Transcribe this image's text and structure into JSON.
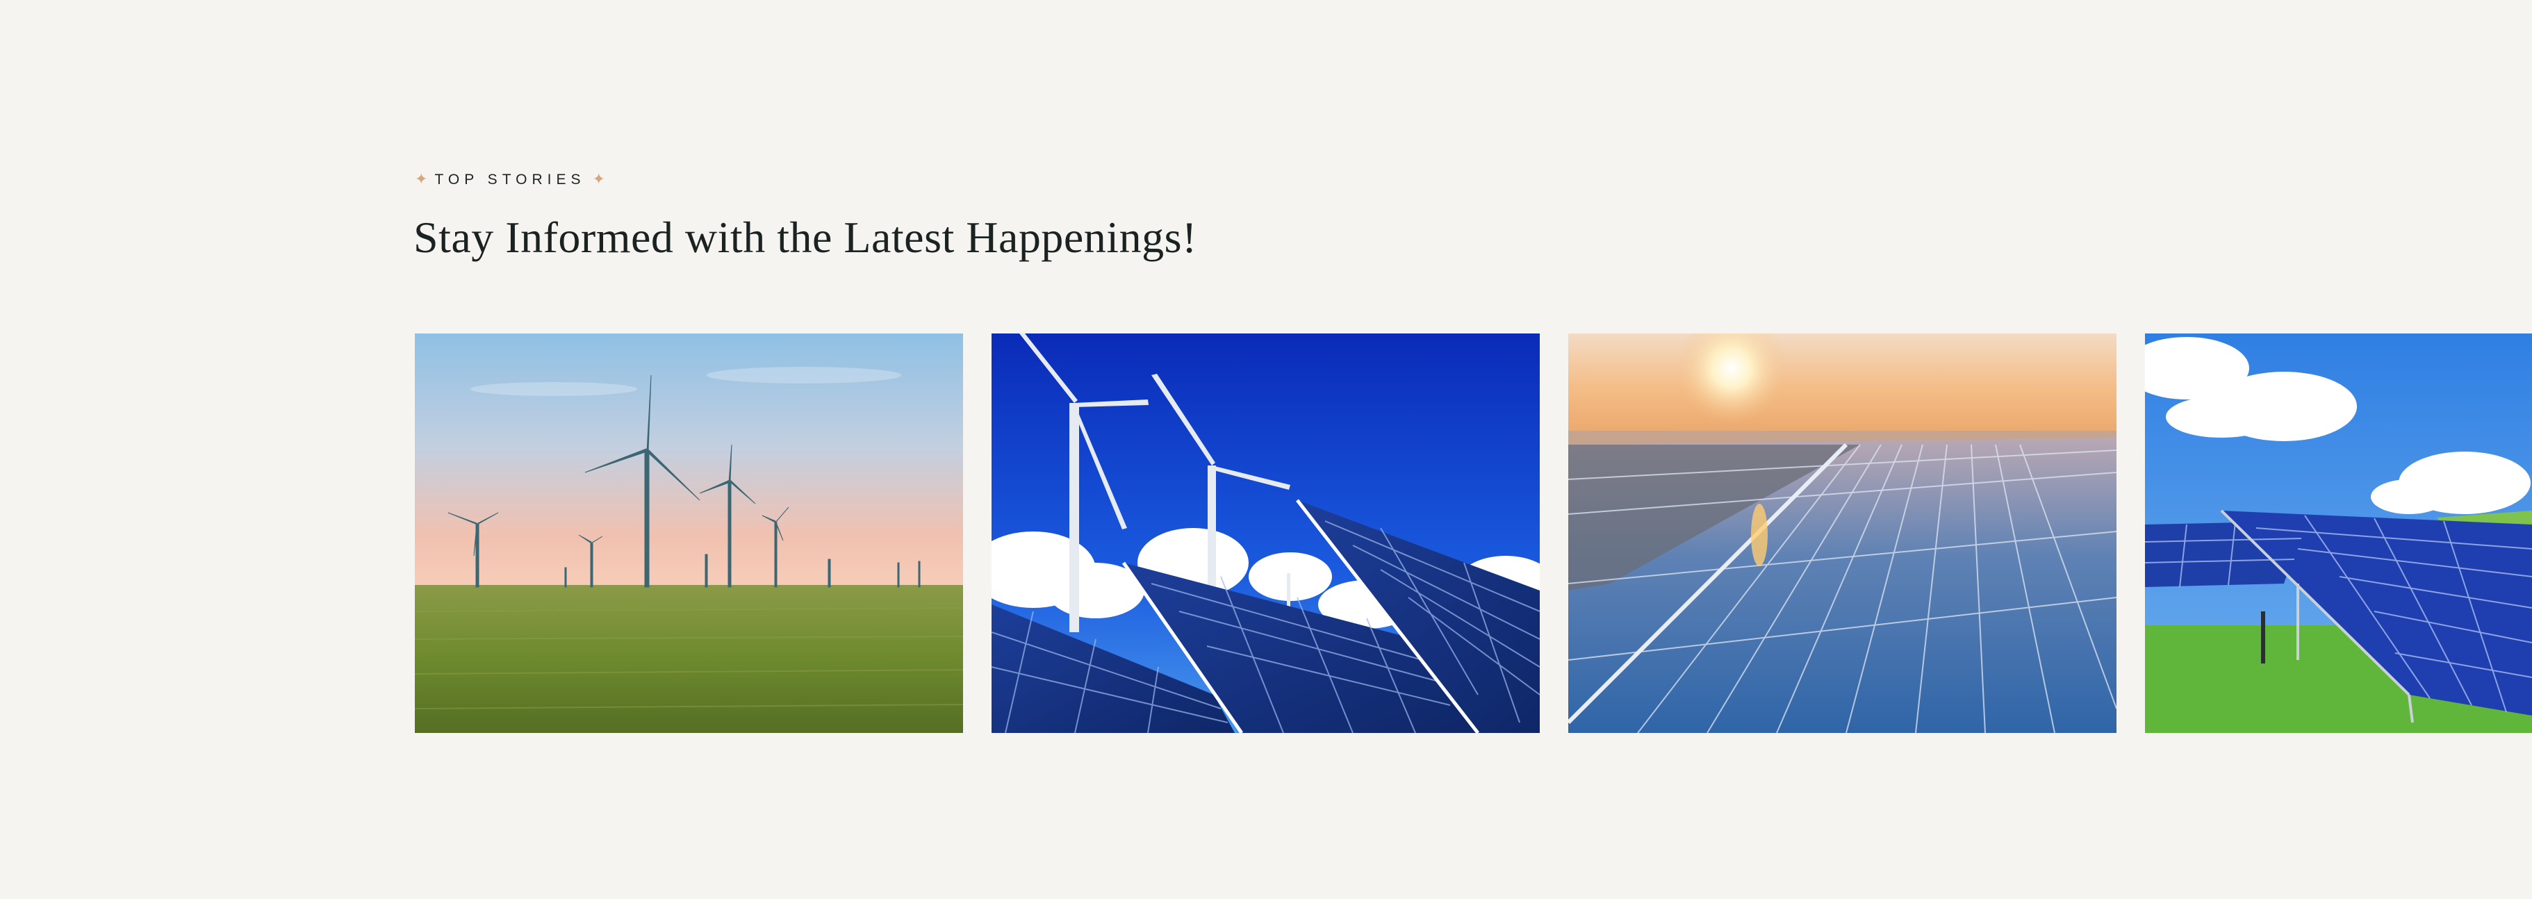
{
  "section": {
    "eyebrow": "TOP STORIES",
    "eyebrow_icon": "sparkle-icon",
    "heading": "Stay Informed with the Latest Happenings!"
  },
  "colors": {
    "background": "#f5f4f0",
    "accent": "#d9a57a",
    "text": "#1a2322"
  },
  "stories": [
    {
      "image": "wind-turbines-wheat-field"
    },
    {
      "image": "wind-turbines-solar-panels-blue-sky"
    },
    {
      "image": "solar-farm-sunset"
    },
    {
      "image": "solar-panels-green-grass"
    }
  ]
}
